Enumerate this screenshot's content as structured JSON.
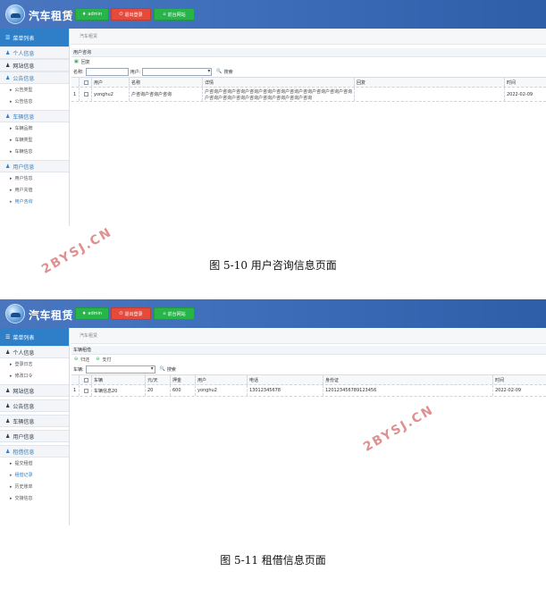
{
  "header": {
    "title": "汽车租赁",
    "admin_label": "admin",
    "logout_label": "退出登录",
    "front_label": "前台网站"
  },
  "shot1": {
    "sidebar": {
      "menu_title": "菜单列表",
      "groups": [
        {
          "label": "个人信息",
          "items": []
        },
        {
          "label": "网站信息",
          "items": []
        },
        {
          "label": "公告信息",
          "items": [
            "公告类型",
            "公告信息"
          ]
        },
        {
          "label": "车辆信息",
          "items": [
            "车辆品牌",
            "车辆类型",
            "车辆信息"
          ]
        },
        {
          "label": "用户信息",
          "items": [
            "用户信息",
            "用户充值",
            "用户咨询"
          ]
        }
      ]
    },
    "breadcrumb": "汽车租赁",
    "panel_title": "用户咨询",
    "toolbar_reply": "回复",
    "search": {
      "name_label": "名称:",
      "user_label": "用户:",
      "button": "搜索"
    },
    "columns": [
      "用户",
      "名称",
      "详情",
      "回复",
      "时间"
    ],
    "rows": [
      {
        "index": "1",
        "user": "yonghu2",
        "name": "户咨询户咨询户咨询",
        "detail": "户咨询户咨询户咨询户咨询户咨询户咨询户咨询户咨询户咨询户咨询户咨询户咨询户咨询户咨询户咨询户咨询户咨询户咨询户咨询",
        "reply": "",
        "time": "2022-02-09"
      }
    ],
    "caption": "图 5-10 用户咨询信息页面"
  },
  "shot2": {
    "sidebar": {
      "menu_title": "菜单列表",
      "groups": [
        {
          "label": "个人信息",
          "items": [
            "登录日志",
            "修改口令"
          ]
        },
        {
          "label": "网站信息",
          "items": []
        },
        {
          "label": "公告信息",
          "items": []
        },
        {
          "label": "车辆信息",
          "items": []
        },
        {
          "label": "用户信息",
          "items": []
        },
        {
          "label": "租借信息",
          "items": [
            "提交租借",
            "租借记录",
            "历史账单",
            "交接信息"
          ]
        }
      ]
    },
    "breadcrumb": "汽车租赁",
    "panel_title": "车辆租借",
    "toolbar_return": "归还",
    "toolbar_pay": "支付",
    "search": {
      "car_label": "车辆:",
      "button": "搜索"
    },
    "columns": [
      "车辆",
      "元/天",
      "押金",
      "用户",
      "电话",
      "身份证",
      "时间"
    ],
    "rows": [
      {
        "index": "1",
        "car": "车辆信息20",
        "price": "20",
        "deposit": "600",
        "user": "yonghu2",
        "phone": "13012345678",
        "idcard": "120123456789123456",
        "time": "2022-02-09"
      }
    ],
    "caption": "图 5-11 租借信息页面"
  },
  "watermark": "2BYSJ.CN",
  "colors": {
    "header": "#3f6fbb",
    "sidebar_active": "#2f7fc8",
    "button_green": "#28b44a",
    "button_red": "#e64a3c",
    "watermark": "#d56b6b"
  }
}
